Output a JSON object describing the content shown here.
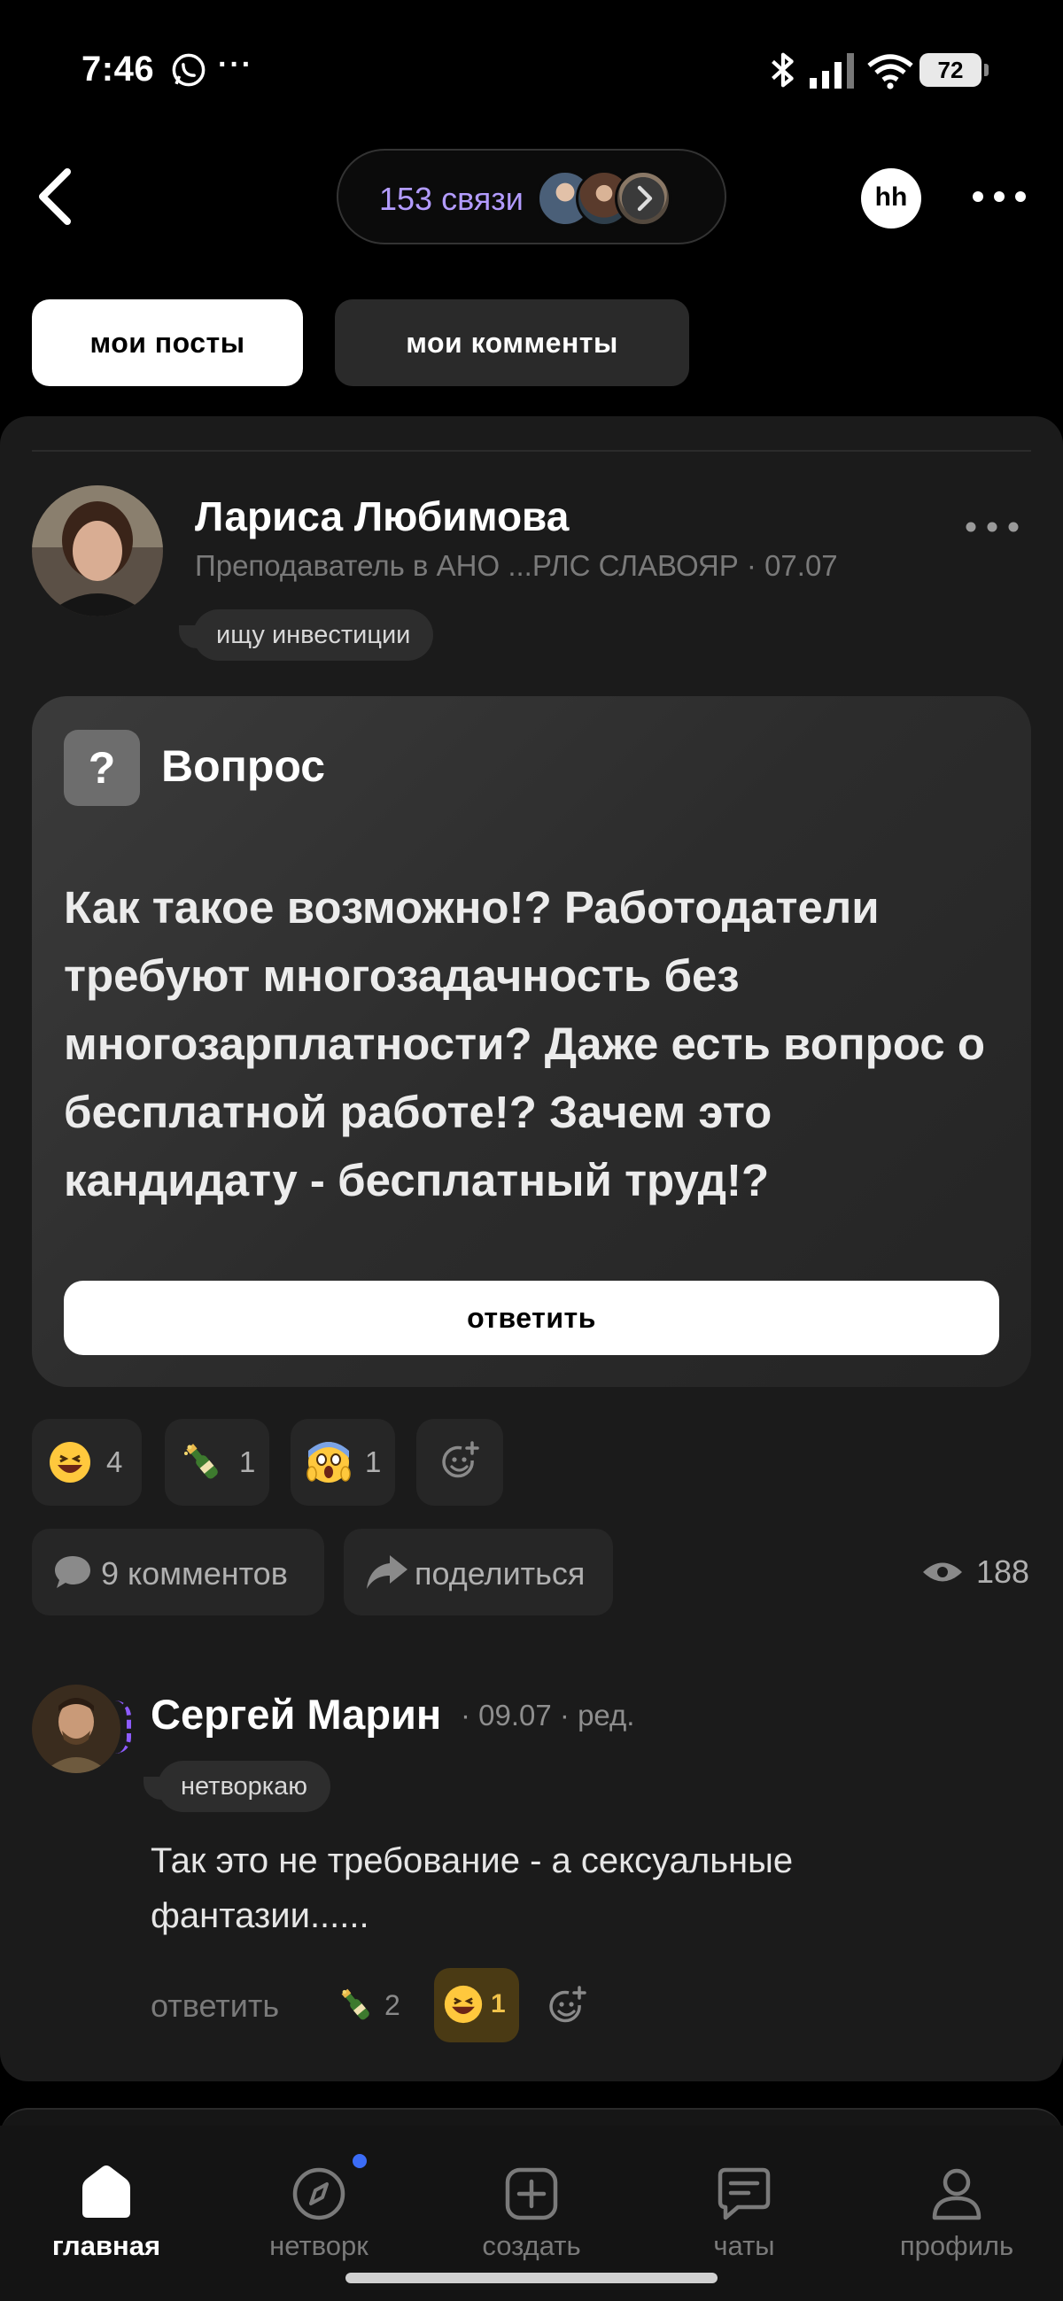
{
  "status_bar": {
    "time": "7:46",
    "battery": "72",
    "overflow_dots": "···"
  },
  "header": {
    "connections_label": "153 связи",
    "logo_text": "hh"
  },
  "tabs": [
    {
      "label": "мои посты",
      "active": true
    },
    {
      "label": "мои комменты",
      "active": false
    }
  ],
  "post": {
    "author_name": "Лариса Любимова",
    "author_meta": "Преподаватель в АНО ...РЛС СЛАВОЯР · 07.07",
    "author_tag": "ищу инвестиции",
    "question_label": "Вопрос",
    "question_icon": "?",
    "question_text": "Как такое возможно!? Работодатели требуют многозадачность без многозарплатности? Даже есть вопрос о бесплатной работе!? Зачем это кандидату - бесплатный труд!?",
    "answer_button": "ответить",
    "reactions": [
      {
        "icon": "grinning-face-icon",
        "count": "4"
      },
      {
        "icon": "champagne-bottle-icon",
        "count": "1"
      },
      {
        "icon": "screaming-face-icon",
        "count": "1"
      }
    ],
    "comments_button": "9 комментов",
    "share_button": "поделиться",
    "views": "188"
  },
  "comment": {
    "author_name": "Сергей Марин",
    "meta": "· 09.07 · ред.",
    "tag": "нетворкаю",
    "text": "Так это не требование - а сексуальные фантазии......",
    "reply_label": "ответить",
    "reactions": [
      {
        "icon": "champagne-bottle-icon",
        "count": "2"
      },
      {
        "icon": "grinning-face-icon",
        "count": "1",
        "highlighted": true
      }
    ]
  },
  "bottom_nav": [
    {
      "label": "главная",
      "icon": "home-icon",
      "active": true
    },
    {
      "label": "нетворк",
      "icon": "compass-icon",
      "active": false,
      "badge": true
    },
    {
      "label": "создать",
      "icon": "plus-square-icon",
      "active": false
    },
    {
      "label": "чаты",
      "icon": "chat-icon",
      "active": false
    },
    {
      "label": "профиль",
      "icon": "profile-icon",
      "active": false
    }
  ],
  "colors": {
    "background": "#000000",
    "card": "#1b1b1b",
    "accent_purple": "#b39cff",
    "badge_blue": "#3b6cf6"
  }
}
